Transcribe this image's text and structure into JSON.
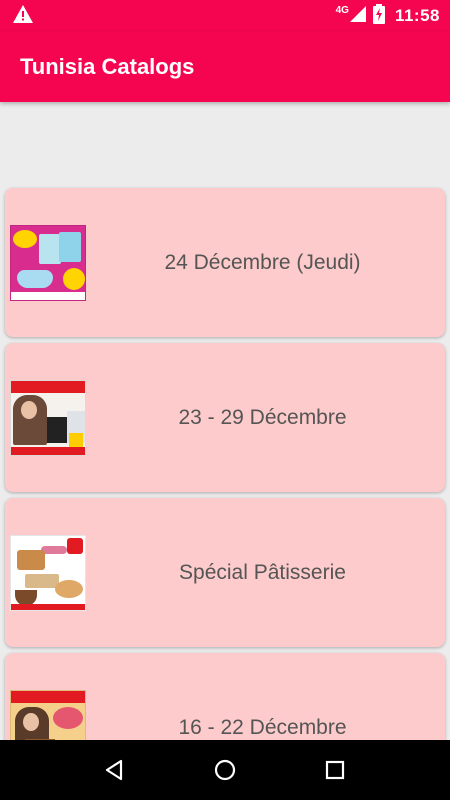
{
  "status_bar": {
    "network": "4G",
    "time": "11:58",
    "icons": [
      "warning-icon",
      "signal-icon",
      "battery-charging-icon"
    ]
  },
  "app_bar": {
    "title": "Tunisia Catalogs",
    "color": "#f5054f"
  },
  "catalogs": [
    {
      "label": "24 Décembre (Jeudi)",
      "thumb": "catalog-thumb-super-promo"
    },
    {
      "label": "23 - 29 Décembre",
      "thumb": "catalog-thumb-aziza"
    },
    {
      "label": "Spécial Pâtisserie",
      "thumb": "catalog-thumb-patisserie"
    },
    {
      "label": "16 - 22 Décembre",
      "thumb": "catalog-thumb-aziza-2"
    }
  ],
  "colors": {
    "card_bg": "#fdcbcb",
    "label_text": "#555555",
    "page_bg": "#ececec"
  },
  "nav_bar": {
    "icons": [
      "back-icon",
      "home-icon",
      "recents-icon"
    ]
  }
}
